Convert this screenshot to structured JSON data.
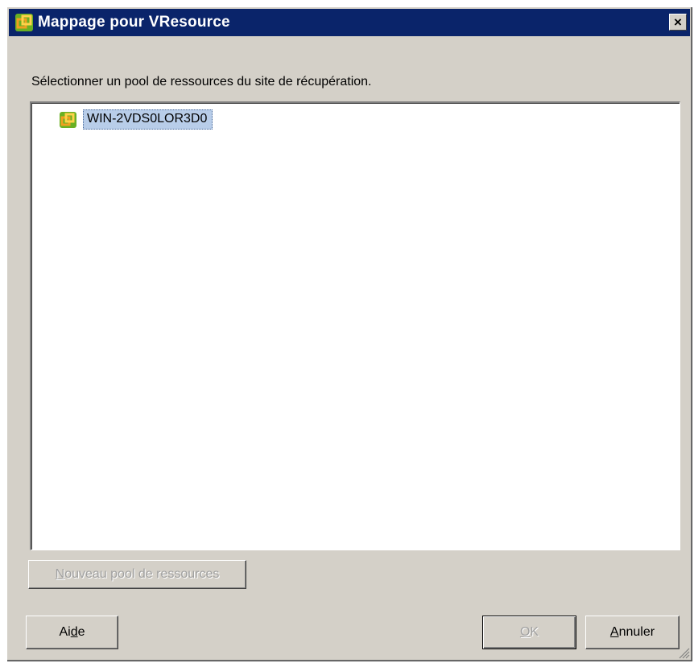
{
  "window": {
    "title": "Mappage pour VResource",
    "close_label": "×"
  },
  "instruction": "Sélectionner un pool de ressources du site de récupération.",
  "tree": {
    "items": [
      {
        "label": "WIN-2VDS0LOR3D0",
        "icon": "resource-pool-icon",
        "selected": true
      }
    ]
  },
  "buttons": {
    "new_pool": {
      "prefix": "N",
      "rest": "ouveau pool de ressources",
      "enabled": false
    },
    "help": {
      "prefix": "Ai",
      "mnemonic": "d",
      "rest": "e"
    },
    "ok": {
      "mnemonic": "O",
      "rest": "K",
      "enabled": false
    },
    "cancel": {
      "mnemonic": "A",
      "rest": "nnuler"
    }
  },
  "colors": {
    "titlebar": "#0a246a",
    "dialog_bg": "#d4d0c8",
    "selection": "#b8cde9",
    "icon_green": "#6ab023",
    "icon_orange": "#f0a020"
  }
}
